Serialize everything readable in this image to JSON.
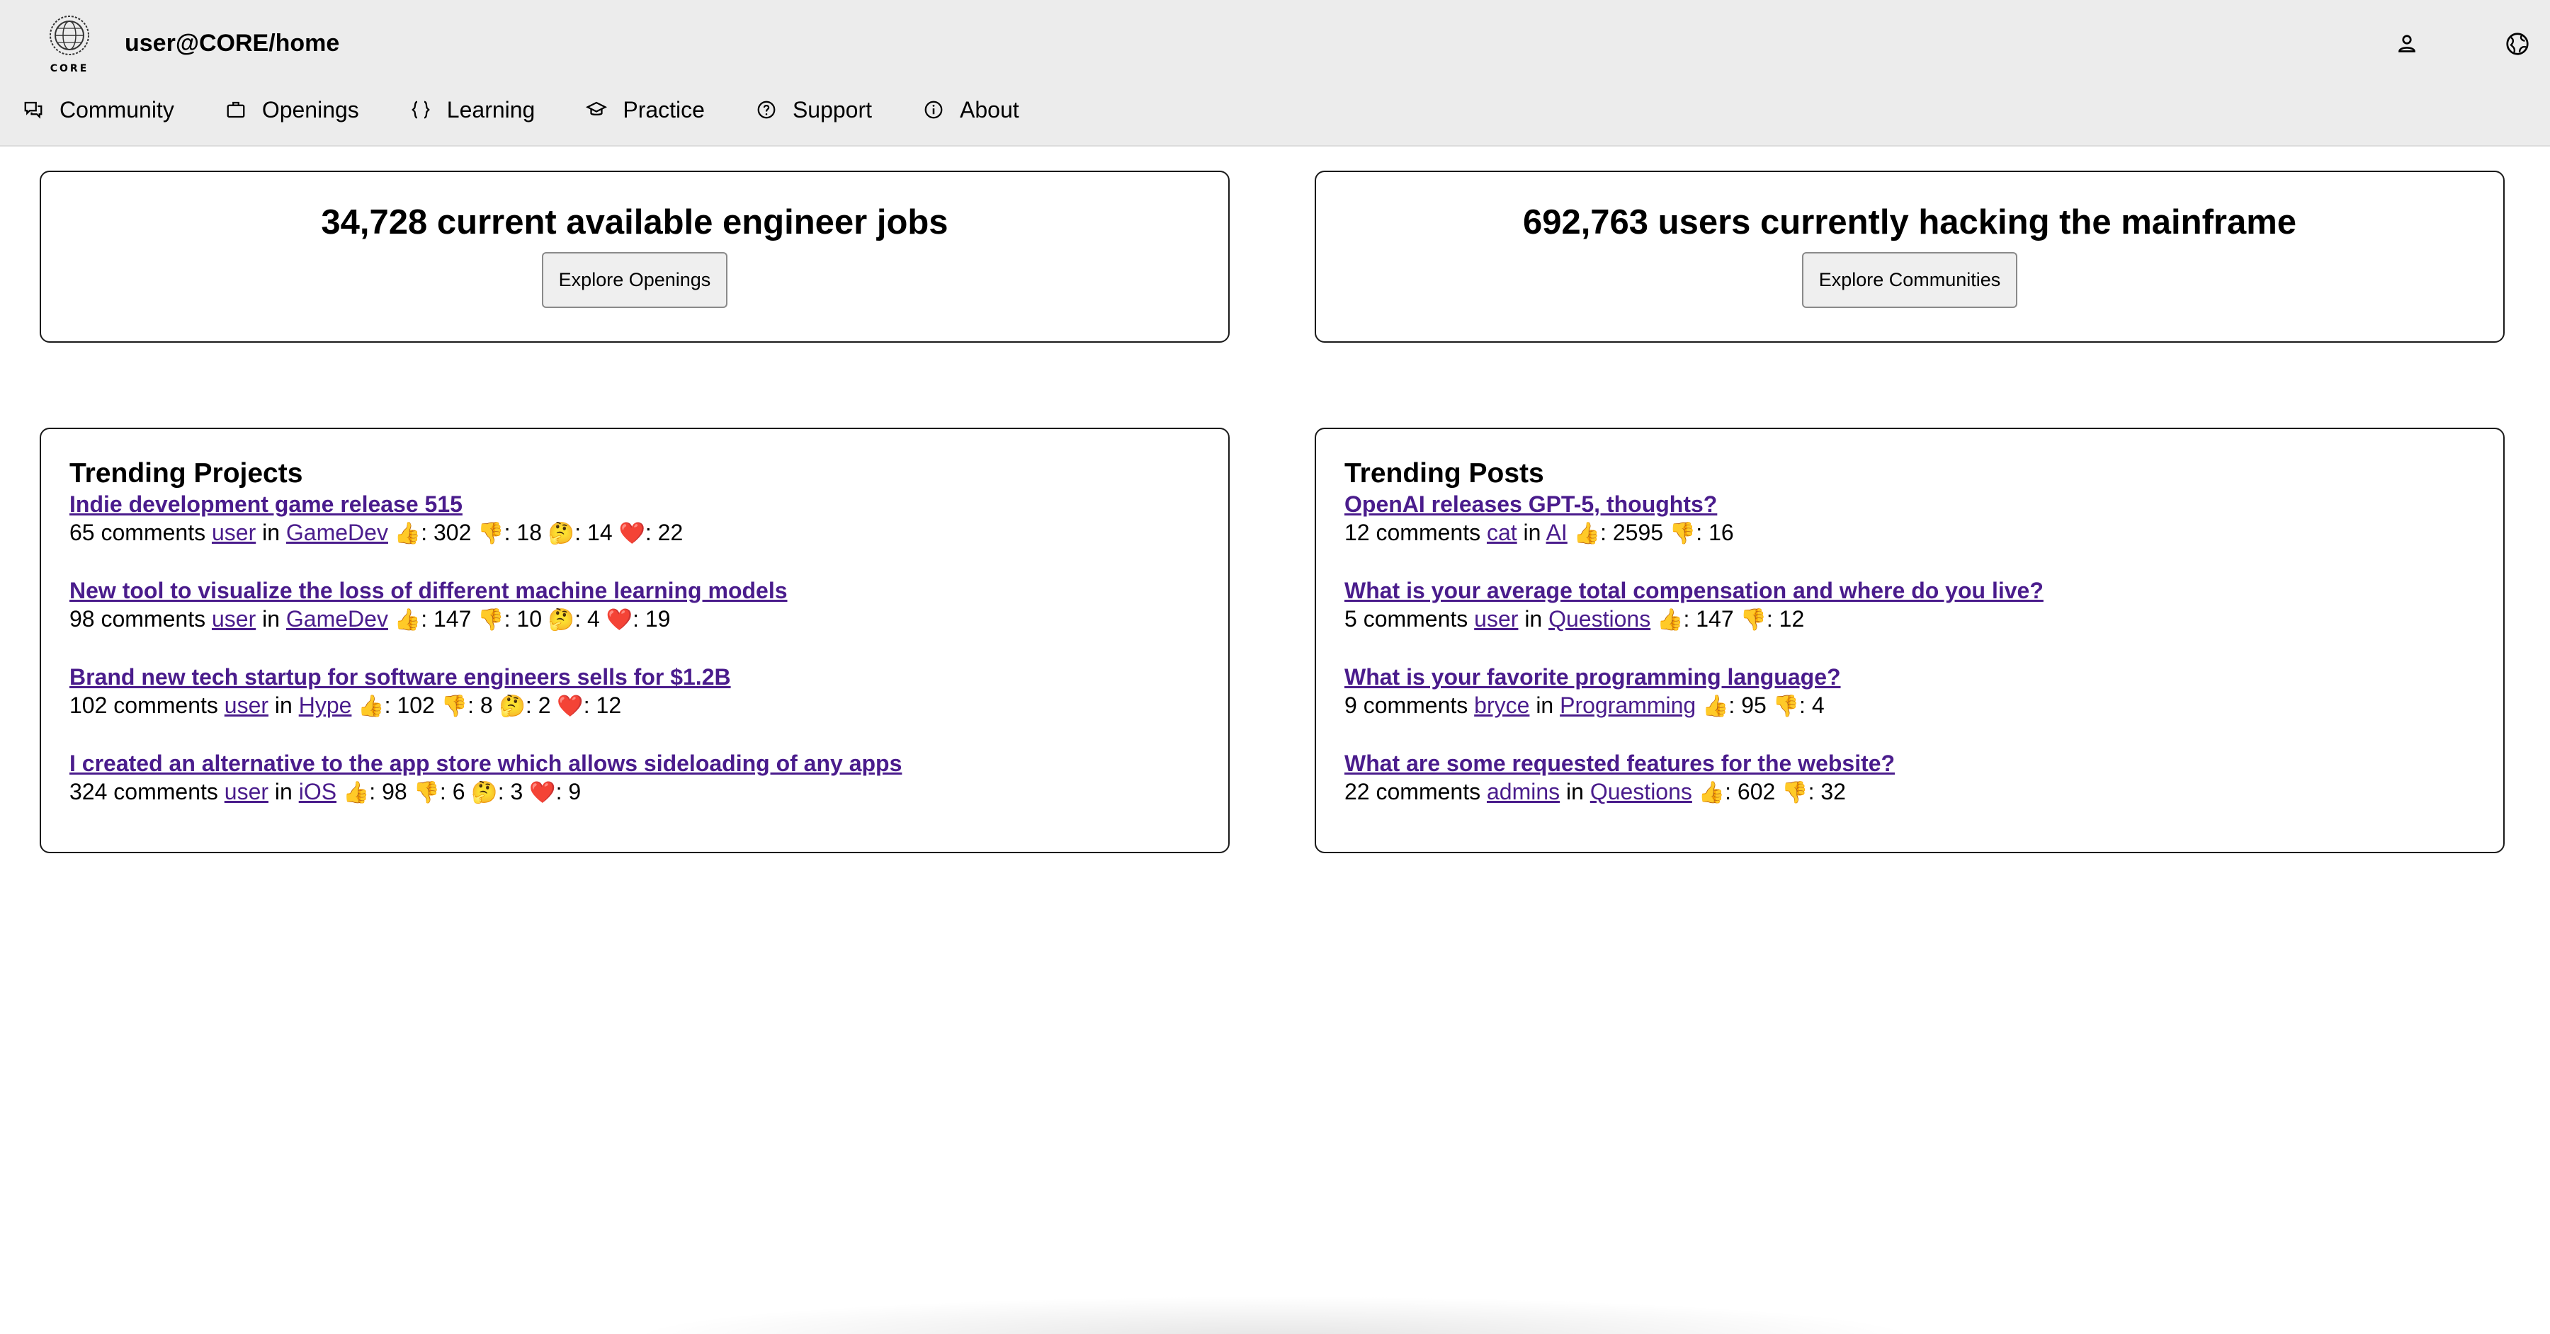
{
  "header": {
    "logo_text": "CORE",
    "site_title": "user@CORE/home",
    "user_icon": "user-icon",
    "globe_icon": "globe-icon"
  },
  "nav": {
    "items": [
      {
        "label": "Community",
        "icon": "chat-icon"
      },
      {
        "label": "Openings",
        "icon": "briefcase-icon"
      },
      {
        "label": "Learning",
        "icon": "braces-icon"
      },
      {
        "label": "Practice",
        "icon": "graduation-cap-icon"
      },
      {
        "label": "Support",
        "icon": "help-circle-icon"
      },
      {
        "label": "About",
        "icon": "info-icon"
      }
    ]
  },
  "stats": {
    "jobs": {
      "title": "34,728 current available engineer jobs",
      "button": "Explore Openings"
    },
    "users": {
      "title": "692,763 users currently hacking the mainframe",
      "button": "Explore Communities"
    }
  },
  "trending_projects": {
    "title": "Trending Projects",
    "items": [
      {
        "title": "Indie development game release 515",
        "comments": "65 comments",
        "author": "user",
        "in": "in",
        "community": "GameDev",
        "likes": "302",
        "dislikes": "18",
        "thinking": "14",
        "hearts": "22"
      },
      {
        "title": "New tool to visualize the loss of different machine learning models",
        "comments": "98 comments",
        "author": "user",
        "in": "in",
        "community": "GameDev",
        "likes": "147",
        "dislikes": "10",
        "thinking": "4",
        "hearts": "19"
      },
      {
        "title": "Brand new tech startup for software engineers sells for $1.2B",
        "comments": "102 comments",
        "author": "user",
        "in": "in",
        "community": "Hype",
        "likes": "102",
        "dislikes": "8",
        "thinking": "2",
        "hearts": "12"
      },
      {
        "title": "I created an alternative to the app store which allows sideloading of any apps",
        "comments": "324 comments",
        "author": "user",
        "in": "in",
        "community": "iOS",
        "likes": "98",
        "dislikes": "6",
        "thinking": "3",
        "hearts": "9"
      }
    ]
  },
  "trending_posts": {
    "title": "Trending Posts",
    "items": [
      {
        "title": "OpenAI releases GPT-5, thoughts?",
        "comments": "12 comments",
        "author": "cat",
        "in": "in",
        "community": "AI",
        "likes": "2595",
        "dislikes": "16"
      },
      {
        "title": "What is your average total compensation and where do you live?",
        "comments": "5 comments",
        "author": "user",
        "in": "in",
        "community": "Questions",
        "likes": "147",
        "dislikes": "12"
      },
      {
        "title": "What is your favorite programming language?",
        "comments": "9 comments",
        "author": "bryce",
        "in": "in",
        "community": "Programming",
        "likes": "95",
        "dislikes": "4"
      },
      {
        "title": "What are some requested features for the website?",
        "comments": "22 comments",
        "author": "admins",
        "in": "in",
        "community": "Questions",
        "likes": "602",
        "dislikes": "32"
      }
    ]
  },
  "emoji": {
    "like": "👍",
    "dislike": "👎",
    "thinking": "🤔",
    "heart": "❤️",
    "sep": ": "
  }
}
